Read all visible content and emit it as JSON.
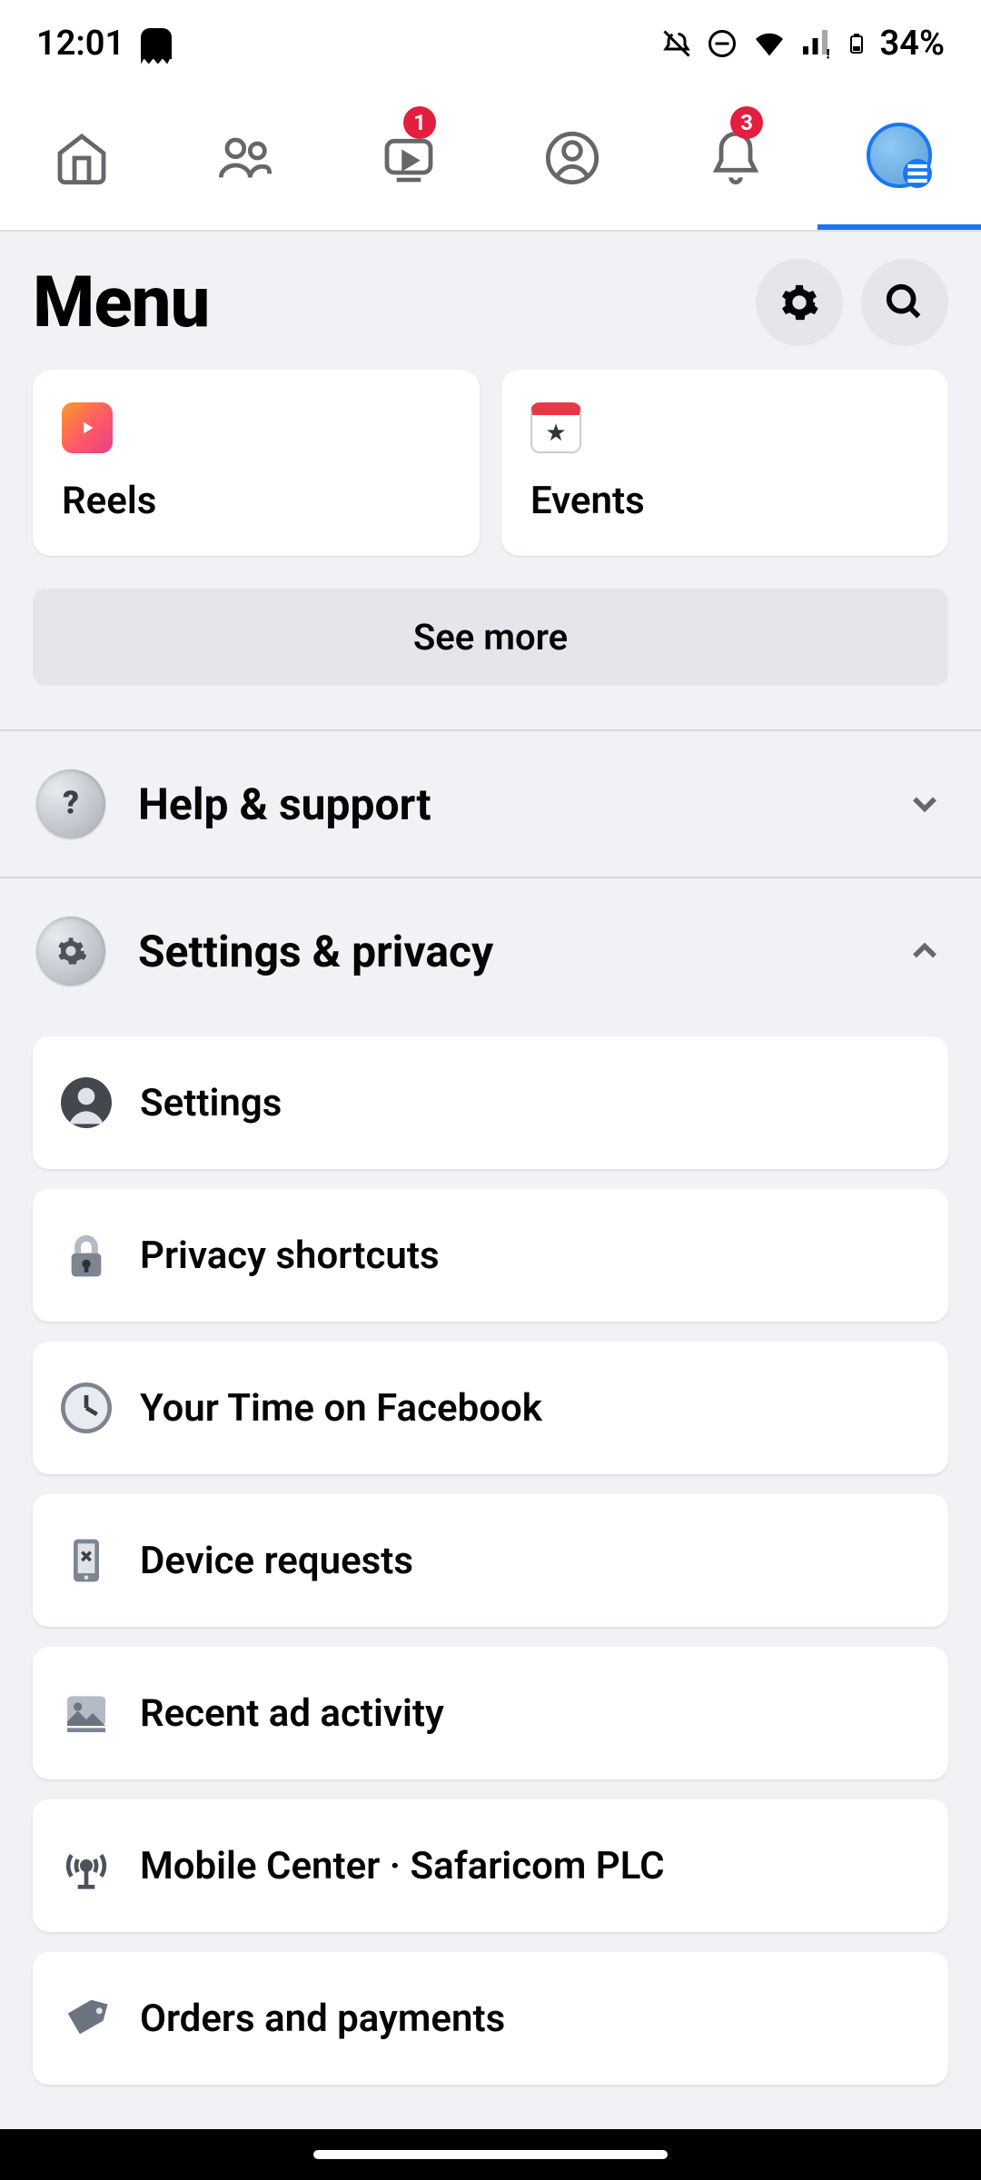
{
  "status": {
    "time": "12:01",
    "battery": "34%"
  },
  "nav": {
    "badges": {
      "watch": "1",
      "notifications": "3"
    }
  },
  "header": {
    "title": "Menu"
  },
  "shortcuts": {
    "reels": "Reels",
    "events": "Events",
    "see_more": "See more"
  },
  "sections": {
    "help": "Help & support",
    "settings_privacy": "Settings & privacy"
  },
  "settings_items": {
    "settings": "Settings",
    "privacy_shortcuts": "Privacy shortcuts",
    "your_time": "Your Time on Facebook",
    "device_requests": "Device requests",
    "recent_ads": "Recent ad activity",
    "mobile_center": "Mobile Center · Safaricom PLC",
    "orders": "Orders and payments"
  }
}
